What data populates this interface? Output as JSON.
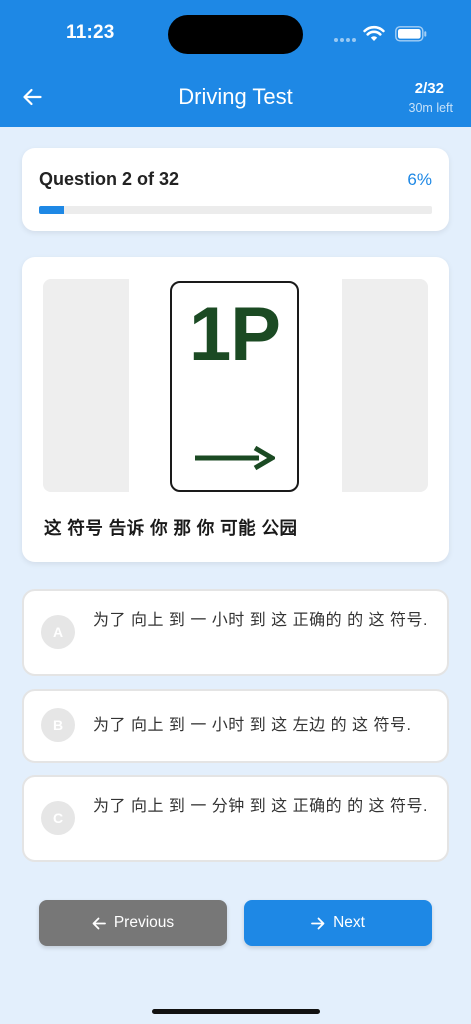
{
  "status_bar": {
    "time": "11:23"
  },
  "header": {
    "title": "Driving Test",
    "progress": "2/32",
    "time_left": "30m left"
  },
  "question_card": {
    "title": "Question 2 of 32",
    "percent_label": "6%",
    "progress_fraction": 0.0625
  },
  "sign": {
    "text": "1P",
    "color": "#1b4a23"
  },
  "question": {
    "text": "这 符号 告诉 你 那 你 可能 公园"
  },
  "options": [
    {
      "letter": "A",
      "text": "为了 向上 到 一 小时 到 这 正确的 的 这 符号."
    },
    {
      "letter": "B",
      "text": "为了 向上 到 一 小时 到 这 左边 的 这 符号."
    },
    {
      "letter": "C",
      "text": "为了 向上 到 一 分钟 到 这 正确的 的 这 符号."
    }
  ],
  "nav": {
    "previous_label": "Previous",
    "next_label": "Next"
  },
  "colors": {
    "accent": "#1e88e5",
    "previous_button": "#777777",
    "background": "#e3effc"
  }
}
